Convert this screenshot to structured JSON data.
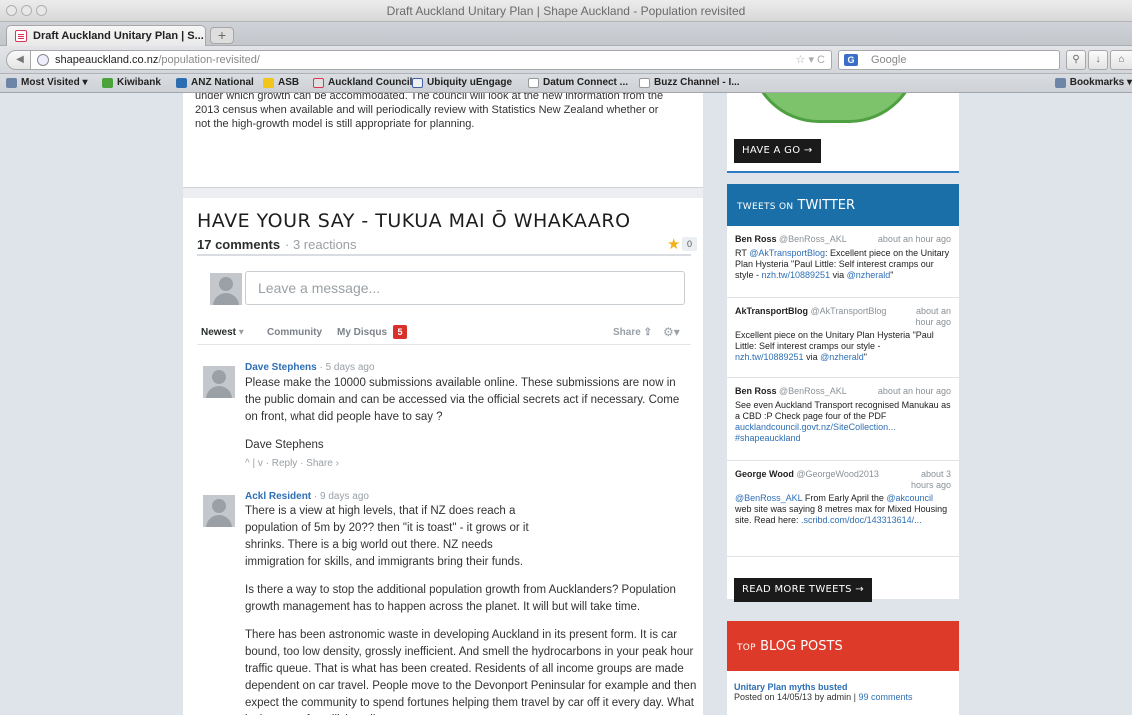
{
  "window": {
    "title": "Draft Auckland Unitary Plan | Shape Auckland - Population revisited"
  },
  "tab": {
    "label": "Draft Auckland Unitary Plan | S...",
    "new_tab": "+"
  },
  "url": {
    "host": "shapeauckland.co.nz",
    "path": "/population-revisited/"
  },
  "search": {
    "placeholder": "Google"
  },
  "bookmarks": {
    "items": [
      "Most Visited",
      "Kiwibank",
      "ANZ National",
      "ASB",
      "Auckland Council",
      "Ubiquity uEngage",
      "Datum Connect ...",
      "Buzz Channel - I..."
    ],
    "right": "Bookmarks"
  },
  "article": {
    "intro": "under which growth can be accommodated. The council will look at the new information from the 2013 census when available and will periodically review with Statistics New Zealand whether or not the high-growth model is still appropriate for planning."
  },
  "section": {
    "heading": "HAVE YOUR SAY - TUKUA MAI Ō WHAKAARO"
  },
  "comments_header": {
    "count": "17 comments",
    "reactions": "· 3 reactions",
    "star_count": "0",
    "placeholder": "Leave a message..."
  },
  "sort_bar": {
    "newest": "Newest",
    "community": "Community",
    "my_disqus": "My Disqus",
    "badge": "5",
    "share": "Share",
    "caret": "▾"
  },
  "comments": [
    {
      "author": "Dave Stephens",
      "time": "· 5 days ago",
      "paragraphs": [
        "Please make the 10000 submissions available online. These submissions are now in the public domain and can be accessed via the official secrets act if necessary. Come on front, what did people have to say ?",
        "Dave Stephens"
      ],
      "actions": "^ | v · Reply · Share ›"
    },
    {
      "author": "Ackl Resident",
      "time": "· 9 days ago",
      "paragraphs": [
        "There is a view at high levels, that if NZ does reach a population of 5m by 20?? then \"it is toast\" - it grows or it shrinks. There is a big world out there. NZ needs immigration for skills, and immigrants bring their funds.",
        "Is there a way to stop the additional population growth from Aucklanders? Population growth management has to happen across the planet. It will but will take time.",
        "There has been astronomic waste in developing Auckland in its present form. It is car bound, too low density, grossly inefficient. And smell the hydrocarbons in your peak hour traffic queue. That is what has been created. Residents of all income groups are made dependent on car travel. People move to the Devonport Peninsular for example and then expect the community to spend fortunes helping them travel by car off it every day. What is the cost of sterilising all"
      ]
    }
  ],
  "sidebar": {
    "have_a_go": "HAVE A GO →",
    "twitter_title_pre": "TWEETS ON",
    "twitter_title": "TWITTER",
    "tweets": [
      {
        "name": "Ben Ross",
        "handle": "@BenRoss_AKL",
        "time": "about an hour ago",
        "text_pre": "RT ",
        "link1": "@AkTransportBlog",
        "text_mid": ": Excellent piece on the Unitary Plan Hysteria \"Paul Little: Self interest cramps our style - ",
        "link2": "nzh.tw/10889251",
        "text_end": " via ",
        "link3": "@nzherald",
        "text_tail": "\""
      },
      {
        "name": "AkTransportBlog",
        "handle": "@AkTransportBlog",
        "time": "about an hour ago",
        "text_pre": "Excellent piece on the Unitary Plan Hysteria \"Paul Little: Self interest cramps our style - ",
        "link1": "nzh.tw/10889251",
        "text_mid": " via ",
        "link2": "@nzherald",
        "text_end": "\""
      },
      {
        "name": "Ben Ross",
        "handle": "@BenRoss_AKL",
        "time": "about an hour ago",
        "text_pre": "See even Auckland Transport recognised Manukau as a CBD :P Check page four of the PDF ",
        "link1": "aucklandcouncil.govt.nz/SiteCollection...",
        "link2": "#shapeauckland"
      },
      {
        "name": "George Wood",
        "handle": "@GeorgeWood2013",
        "time": "about 3 hours ago",
        "link1": "@BenRoss_AKL",
        "text_pre": " From Early April the ",
        "link2": "@akcouncil",
        "text_mid": " web site was saying 8 metres max for Mixed Housing site. Read here: ",
        "link3": ".scribd.com/doc/143313614/..."
      }
    ],
    "read_more": "READ MORE TWEETS →",
    "blog_title_pre": "TOP",
    "blog_title": "BLOG POSTS",
    "blog_post": {
      "title": "Unitary Plan myths busted",
      "meta_pre": "Posted on 14/05/13 by admin | ",
      "comments": "99 comments"
    }
  }
}
